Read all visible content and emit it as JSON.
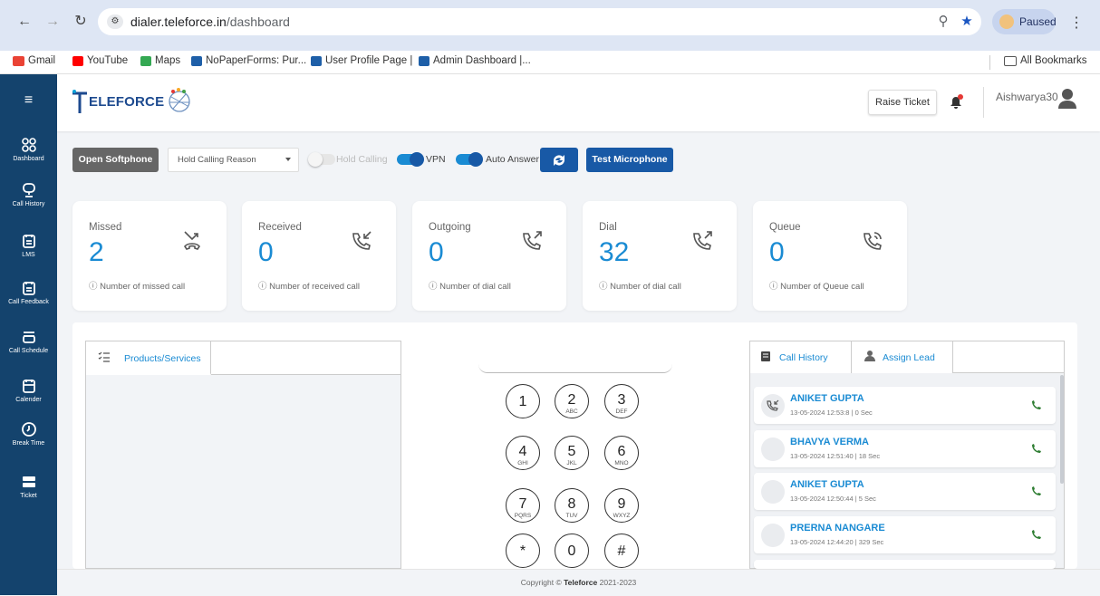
{
  "browser": {
    "url_domain": "dialer.teleforce.in",
    "url_path": "/dashboard",
    "profile_status": "Paused",
    "bookmarks": [
      "Gmail",
      "YouTube",
      "Maps",
      "NoPaperForms: Pur...",
      "User Profile Page |",
      "Admin Dashboard |..."
    ],
    "all_bookmarks": "All Bookmarks"
  },
  "header": {
    "logo_text": "ELEFORCE",
    "raise_ticket": "Raise Ticket",
    "username": "Aishwarya30"
  },
  "sidebar": {
    "items": [
      {
        "label": "Dashboard",
        "icon": "dashboard-icon"
      },
      {
        "label": "Call History",
        "icon": "call-history-icon"
      },
      {
        "label": "LMS",
        "icon": "lms-icon"
      },
      {
        "label": "Call Feedback",
        "icon": "call-feedback-icon"
      },
      {
        "label": "Call Schedule",
        "icon": "call-schedule-icon"
      },
      {
        "label": "Calender",
        "icon": "calendar-icon"
      },
      {
        "label": "Break Time",
        "icon": "clock-icon"
      },
      {
        "label": "Ticket",
        "icon": "ticket-icon"
      }
    ]
  },
  "controls": {
    "open_softphone": "Open Softphone",
    "hold_reason_placeholder": "Hold Calling Reason",
    "hold_calling": "Hold Calling",
    "vpn": "VPN",
    "auto_answer": "Auto Answer",
    "test_microphone": "Test Microphone",
    "hold_calling_on": false,
    "vpn_on": true,
    "auto_answer_on": true
  },
  "stats": [
    {
      "title": "Missed",
      "value": "2",
      "note": "ⓘ Number of missed call",
      "icon": "missed-call-icon"
    },
    {
      "title": "Received",
      "value": "0",
      "note": "ⓘ Number of received call",
      "icon": "received-call-icon"
    },
    {
      "title": "Outgoing",
      "value": "0",
      "note": "ⓘ Number of dial call",
      "icon": "outgoing-call-icon"
    },
    {
      "title": "Dial",
      "value": "32",
      "note": "ⓘ Number of dial call",
      "icon": "dial-call-icon"
    },
    {
      "title": "Queue",
      "value": "0",
      "note": "ⓘ Number of Queue call",
      "icon": "queue-call-icon"
    }
  ],
  "products_tab": "Products/Services",
  "dialpad": [
    {
      "k": "1",
      "s": ""
    },
    {
      "k": "2",
      "s": "ABC"
    },
    {
      "k": "3",
      "s": "DEF"
    },
    {
      "k": "4",
      "s": "GHI"
    },
    {
      "k": "5",
      "s": "JKL"
    },
    {
      "k": "6",
      "s": "MNO"
    },
    {
      "k": "7",
      "s": "PQRS"
    },
    {
      "k": "8",
      "s": "TUV"
    },
    {
      "k": "9",
      "s": "WXYZ"
    },
    {
      "k": "*",
      "s": ""
    },
    {
      "k": "0",
      "s": ""
    },
    {
      "k": "#",
      "s": ""
    }
  ],
  "history_tabs": {
    "call_history": "Call History",
    "assign_lead": "Assign Lead"
  },
  "call_history": [
    {
      "name": "ANIKET GUPTA",
      "meta": "13-05-2024 12:53:8 | 0 Sec"
    },
    {
      "name": "BHAVYA VERMA",
      "meta": "13-05-2024 12:51:40 | 18 Sec"
    },
    {
      "name": "ANIKET GUPTA",
      "meta": "13-05-2024 12:50:44 | 5 Sec"
    },
    {
      "name": "PRERNA NANGARE",
      "meta": "13-05-2024 12:44:20 | 329 Sec"
    }
  ],
  "footer": {
    "prefix": "Copyright © ",
    "brand": "Teleforce",
    "years": " 2021-2023"
  },
  "colors": {
    "sidebar": "#14436d",
    "accent": "#1a8bd3",
    "button_blue": "#1859a6",
    "phone_green": "#2e7d32"
  }
}
